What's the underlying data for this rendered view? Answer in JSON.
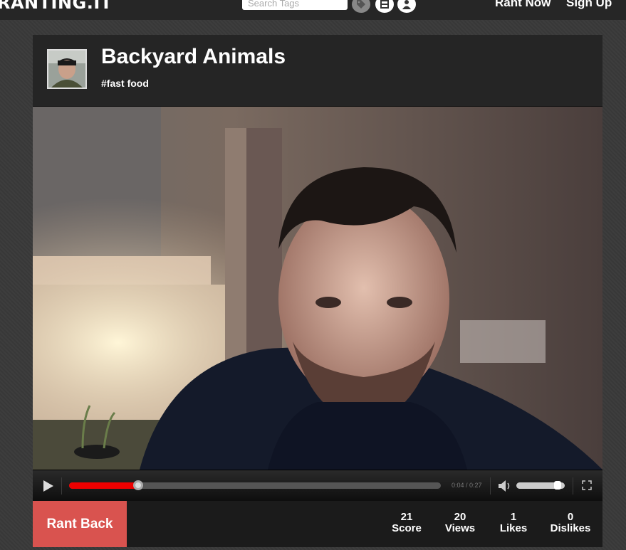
{
  "header": {
    "logo": "RANTING.IT",
    "search_placeholder": "Search Tags",
    "icons": [
      "tag-icon",
      "film-icon",
      "user-icon"
    ],
    "rant_now": "Rant Now",
    "sign_up": "Sign Up"
  },
  "rant": {
    "title": "Backyard Animals",
    "tag": "#fast food"
  },
  "player": {
    "time": "0:04 / 0:27",
    "progress": 0.185,
    "volume": 0.9,
    "progress_color": "#ee0000"
  },
  "actions": {
    "rant_back": "Rant Back",
    "rant_back_color": "#d9534f"
  },
  "stats": [
    {
      "value": "21",
      "label": "Score"
    },
    {
      "value": "20",
      "label": "Views"
    },
    {
      "value": "1",
      "label": "Likes"
    },
    {
      "value": "0",
      "label": "Dislikes"
    }
  ]
}
